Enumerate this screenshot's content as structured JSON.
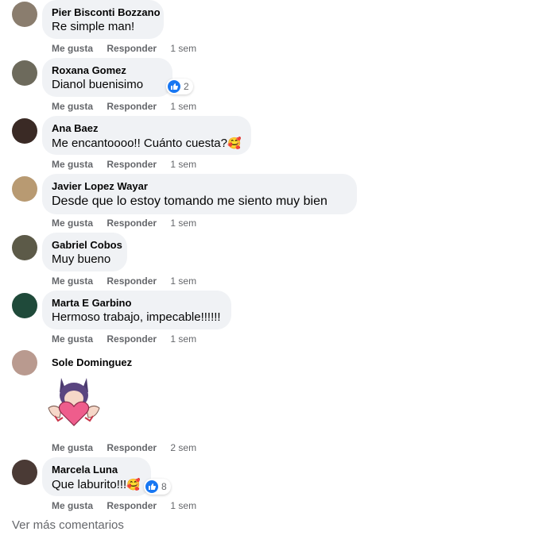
{
  "comments": [
    {
      "author": "Pier Bisconti Bozzano",
      "text": "Re simple man!",
      "like": "Me gusta",
      "reply": "Responder",
      "time": "1 sem",
      "avatar_color": "#8a7d6e"
    },
    {
      "author": "Roxana Gomez",
      "text": "Dianol buenisimo",
      "like": "Me gusta",
      "reply": "Responder",
      "time": "1 sem",
      "reactions": "2",
      "avatar_color": "#6d6a5c"
    },
    {
      "author": "Ana Baez",
      "text": "Me encantoooo!! Cuánto cuesta?",
      "emoji": "🥰",
      "like": "Me gusta",
      "reply": "Responder",
      "time": "1 sem",
      "avatar_color": "#3a2a25"
    },
    {
      "author": "Javier Lopez Wayar",
      "text": "Desde que lo estoy tomando me siento muy bien",
      "like": "Me gusta",
      "reply": "Responder",
      "time": "1 sem",
      "avatar_color": "#b89a72"
    },
    {
      "author": "Gabriel Cobos",
      "text": "Muy bueno",
      "like": "Me gusta",
      "reply": "Responder",
      "time": "1 sem",
      "avatar_color": "#5c5a48"
    },
    {
      "author": "Marta E Garbino",
      "text": "Hermoso trabajo, impecable!!!!!!",
      "like": "Me gusta",
      "reply": "Responder",
      "time": "1 sem",
      "avatar_color": "#1f4a3a"
    },
    {
      "author": "Sole Dominguez",
      "text": "",
      "like": "Me gusta",
      "reply": "Responder",
      "time": "2 sem",
      "avatar_color": "#b99a8f"
    },
    {
      "author": "Marcela Luna",
      "text": "Que laburito!!!",
      "emoji": "🥰",
      "like": "Me gusta",
      "reply": "Responder",
      "time": "1 sem",
      "reactions": "8",
      "avatar_color": "#4a3a35"
    }
  ],
  "more_comments": "Ver más comentarios",
  "colors": {
    "bubble": "#f0f2f5",
    "secondary_text": "#65676b",
    "like_blue": "#1877f2"
  }
}
